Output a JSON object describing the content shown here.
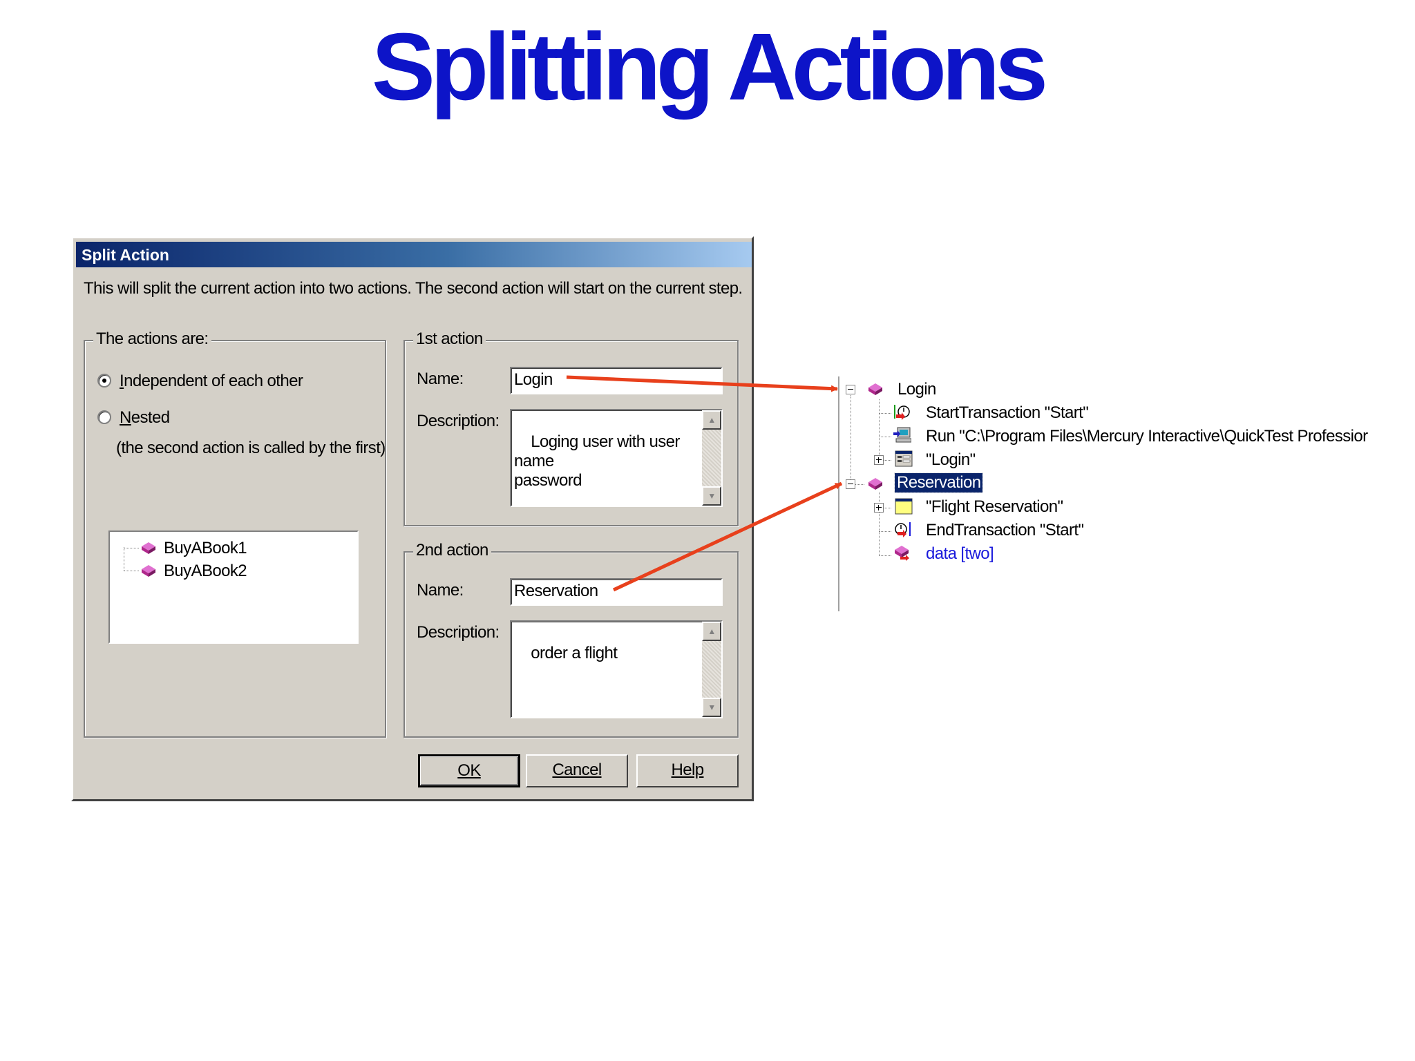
{
  "slide": {
    "title": "Splitting Actions"
  },
  "dialog": {
    "title": "Split Action",
    "message": "This will split the current action into two actions. The second action will start on the current step.",
    "actions_group": {
      "legend": "The actions are:",
      "option_independent": "Independent of each other",
      "option_nested": "Nested",
      "nested_hint": "(the second action is called by the first)",
      "selected": "Independent of each other",
      "tree_items": [
        "BuyABook1",
        "BuyABook2"
      ]
    },
    "first_action": {
      "legend": "1st action",
      "name_label": "Name:",
      "name_value": "Login",
      "description_label": "Description:",
      "description_value": "Loging user with user name\npassword"
    },
    "second_action": {
      "legend": "2nd action",
      "name_label": "Name:",
      "name_value": "Reservation",
      "description_label": "Description:",
      "description_value": "order a flight"
    },
    "buttons": {
      "ok": "OK",
      "cancel": "Cancel",
      "help": "Help"
    }
  },
  "test_tree": {
    "login": "Login",
    "start_transaction": "StartTransaction \"Start\"",
    "run": "Run \"C:\\Program Files\\Mercury Interactive\\QuickTest Professior",
    "login_page": "\"Login\"",
    "reservation": "Reservation",
    "flight_reservation": "\"Flight Reservation\"",
    "end_transaction": "EndTransaction \"Start\"",
    "data": "data [two]"
  },
  "colors": {
    "title": "#0d14c8",
    "arrow": "#e8401c",
    "selection": "#0a246a",
    "link": "#1a1adc",
    "action_icon": "#b0288c"
  }
}
